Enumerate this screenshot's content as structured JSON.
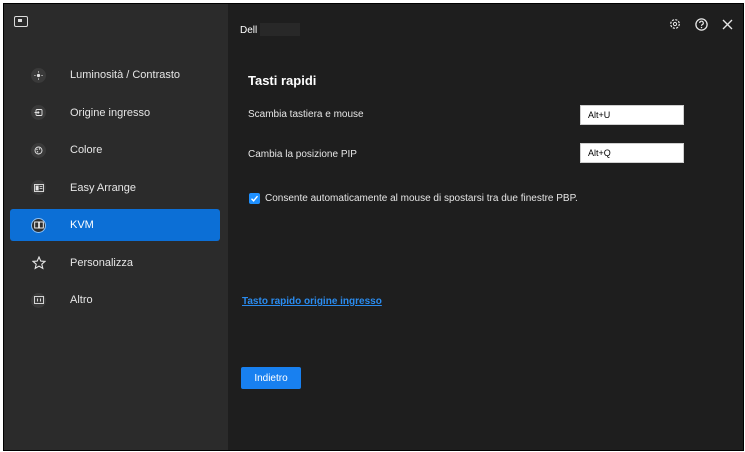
{
  "app": {
    "brand_label": "Dell"
  },
  "sidebar": {
    "items": [
      {
        "label": "Luminosità / Contrasto"
      },
      {
        "label": "Origine ingresso"
      },
      {
        "label": "Colore"
      },
      {
        "label": "Easy Arrange"
      },
      {
        "label": "KVM",
        "active": true
      },
      {
        "label": "Personalizza"
      },
      {
        "label": "Altro"
      }
    ]
  },
  "main": {
    "section_title": "Tasti rapidi",
    "rows": [
      {
        "label": "Scambia tastiera e mouse",
        "value": "Alt+U"
      },
      {
        "label": "Cambia la posizione PIP",
        "value": "Alt+Q"
      }
    ],
    "checkbox": {
      "label": "Consente automaticamente al mouse di spostarsi tra due finestre PBP.",
      "checked": true
    },
    "link": "Tasto rapido origine ingresso",
    "back_button": "Indietro"
  },
  "colors": {
    "accent": "#0c6fd6",
    "sidebar_bg": "#2b2b2b",
    "main_bg": "#1e1e1e",
    "link": "#2a8cf0"
  },
  "icons": [
    "monitor-icon",
    "brightness-icon",
    "input-source-icon",
    "color-icon",
    "easy-arrange-icon",
    "kvm-icon",
    "star-icon",
    "other-icon",
    "settings-icon",
    "help-icon",
    "close-icon"
  ]
}
